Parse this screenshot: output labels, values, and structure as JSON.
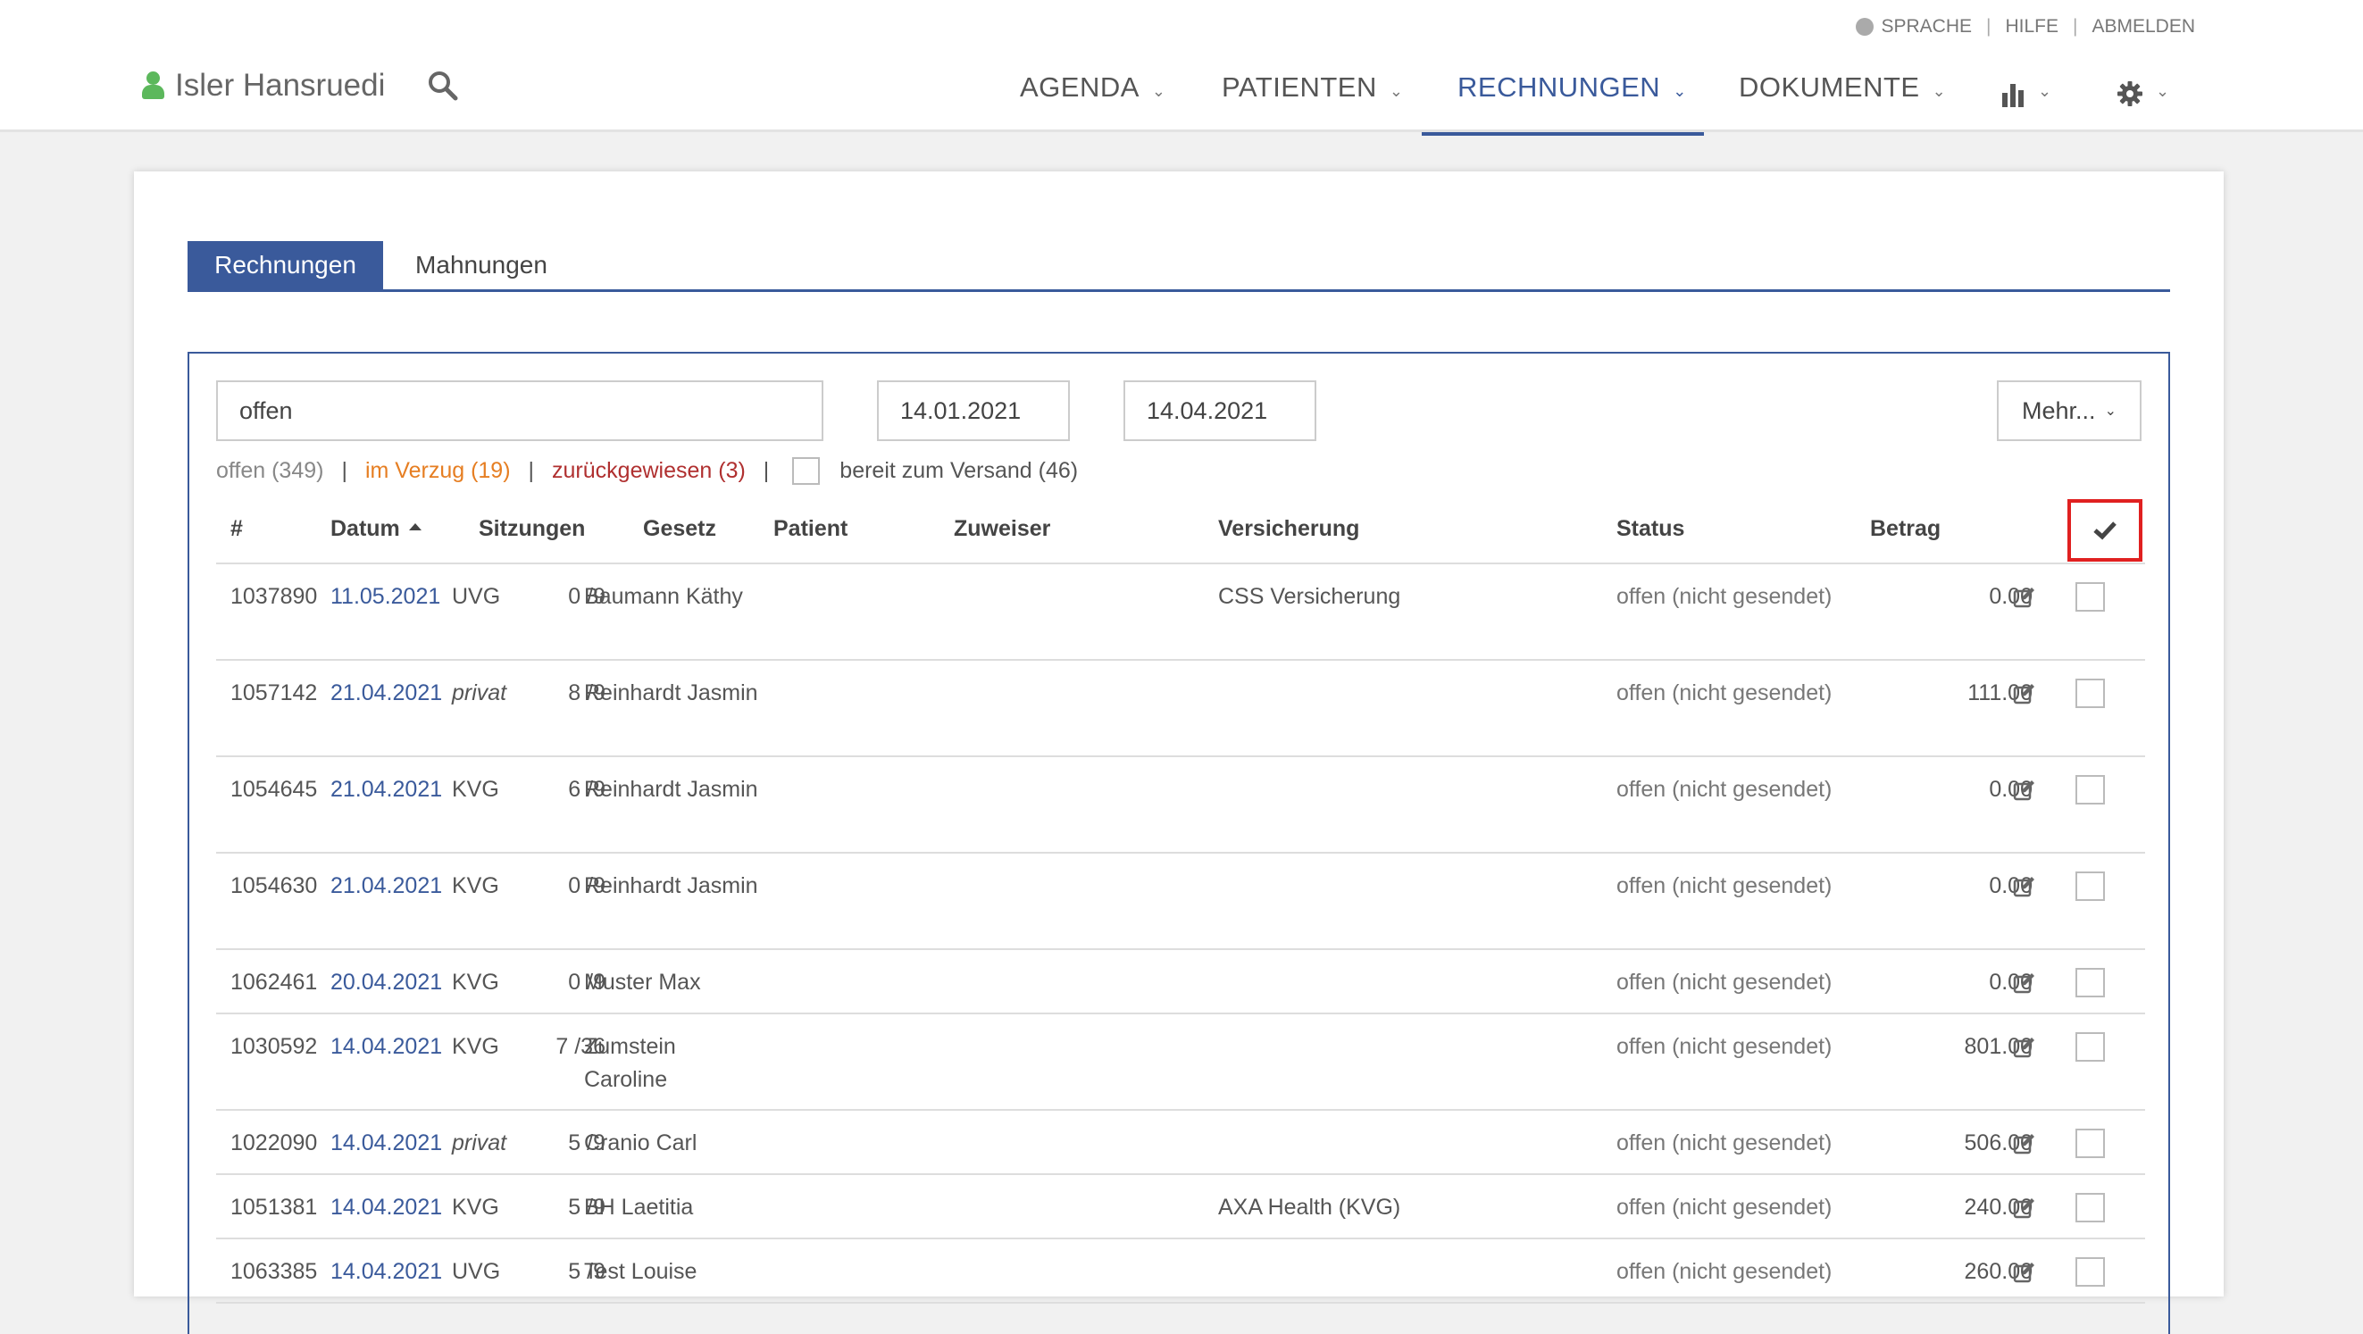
{
  "top_links": {
    "language": "SPRACHE",
    "help": "HILFE",
    "logout": "ABMELDEN"
  },
  "user": {
    "name": "Isler Hansruedi"
  },
  "nav": {
    "agenda": "AGENDA",
    "patients": "PATIENTEN",
    "invoices": "RECHNUNGEN",
    "documents": "DOKUMENTE",
    "active": "RECHNUNGEN"
  },
  "tabs": {
    "invoices": "Rechnungen",
    "reminders": "Mahnungen"
  },
  "filters": {
    "status_value": "offen",
    "date_from": "14.01.2021",
    "date_to": "14.04.2021",
    "more_button": "Mehr...",
    "quick_open": "offen (349)",
    "quick_overdue": "im Verzug (19)",
    "quick_rejected": "zurückgewiesen (3)",
    "quick_ready": "bereit zum Versand (46)"
  },
  "columns": {
    "num": "#",
    "date": "Datum",
    "sessions": "Sitzungen",
    "law": "Gesetz",
    "patient": "Patient",
    "referrer": "Zuweiser",
    "insurance": "Versicherung",
    "status": "Status",
    "amount": "Betrag"
  },
  "rows": [
    {
      "num": "1037890",
      "date": "11.05.2021",
      "sessions": "0 /9",
      "law": "UVG",
      "patient": "Baumann Käthy",
      "insurance": "CSS Versicherung",
      "status": "offen (nicht gesendet)",
      "amount": "0.00"
    },
    {
      "num": "1057142",
      "date": "21.04.2021",
      "sessions": "8 /9",
      "law": "privat",
      "patient": "Reinhardt Jasmin",
      "insurance": "",
      "status": "offen (nicht gesendet)",
      "amount": "111.00"
    },
    {
      "num": "1054645",
      "date": "21.04.2021",
      "sessions": "6 /9",
      "law": "KVG",
      "patient": "Reinhardt Jasmin",
      "insurance": "",
      "status": "offen (nicht gesendet)",
      "amount": "0.00"
    },
    {
      "num": "1054630",
      "date": "21.04.2021",
      "sessions": "0 /9",
      "law": "KVG",
      "patient": "Reinhardt Jasmin",
      "insurance": "",
      "status": "offen (nicht gesendet)",
      "amount": "0.00"
    },
    {
      "num": "1062461",
      "date": "20.04.2021",
      "sessions": "0 /9",
      "law": "KVG",
      "patient": "Muster Max",
      "insurance": "",
      "status": "offen (nicht gesendet)",
      "amount": "0.00"
    },
    {
      "num": "1030592",
      "date": "14.04.2021",
      "sessions": "7 /36",
      "law": "KVG",
      "patient": "Zumstein Caroline",
      "insurance": "",
      "status": "offen (nicht gesendet)",
      "amount": "801.00"
    },
    {
      "num": "1022090",
      "date": "14.04.2021",
      "sessions": "5 /9",
      "law": "privat",
      "patient": "Cranio Carl",
      "insurance": "",
      "status": "offen (nicht gesendet)",
      "amount": "506.00"
    },
    {
      "num": "1051381",
      "date": "14.04.2021",
      "sessions": "5 /9",
      "law": "KVG",
      "patient": "BH Laetitia",
      "insurance": "AXA Health (KVG)",
      "status": "offen (nicht gesendet)",
      "amount": "240.00"
    },
    {
      "num": "1063385",
      "date": "14.04.2021",
      "sessions": "5 /9",
      "law": "UVG",
      "patient": "Test Louise",
      "insurance": "",
      "status": "offen (nicht gesendet)",
      "amount": "260.00"
    }
  ]
}
